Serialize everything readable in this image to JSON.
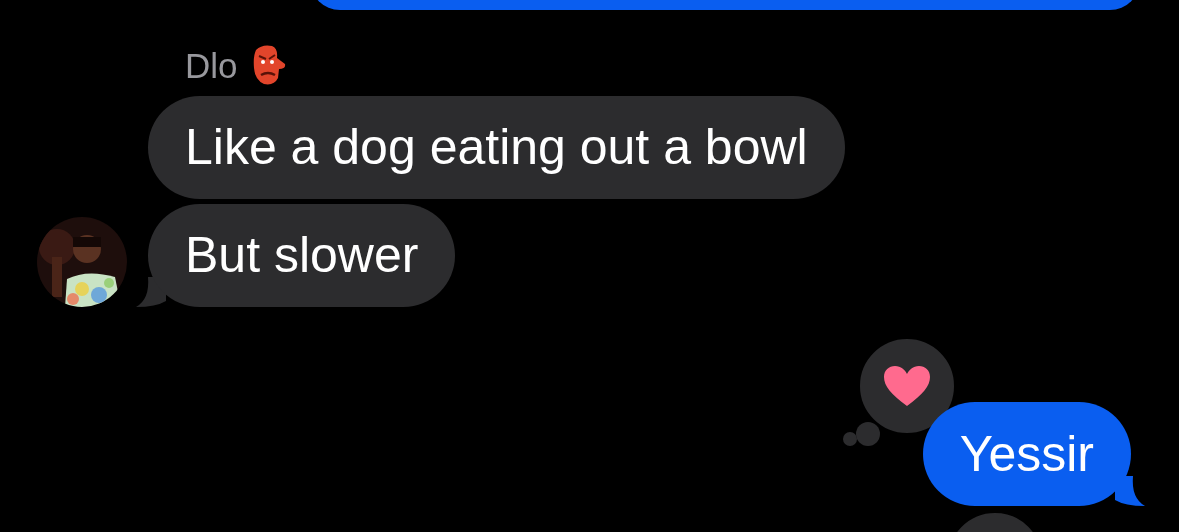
{
  "thread": {
    "sender": "Dlo",
    "messages": [
      {
        "kind": "outgoing"
      },
      {
        "kind": "incoming",
        "text": "Like a dog eating out a bowl",
        "tail": false,
        "avatar": false
      },
      {
        "kind": "incoming",
        "text": "But slower",
        "tail": true,
        "avatar": true
      },
      {
        "kind": "outgoing",
        "text": "Yessir",
        "tail": true,
        "reaction": {
          "kind": "heart"
        }
      }
    ]
  }
}
